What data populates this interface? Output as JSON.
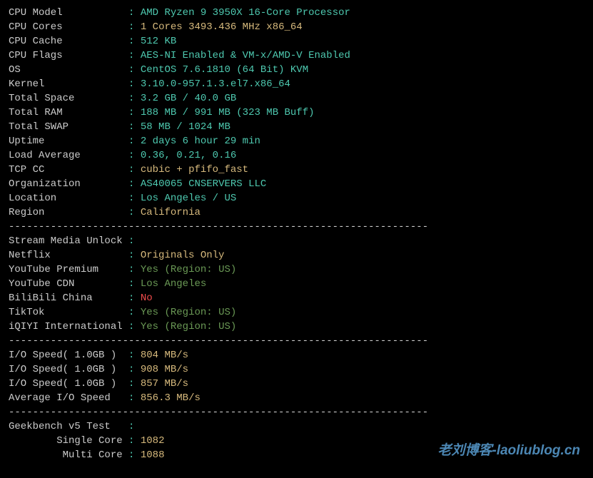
{
  "labels": {
    "cpu_model": "CPU Model",
    "cpu_cores": "CPU Cores",
    "cpu_cache": "CPU Cache",
    "cpu_flags": "CPU Flags",
    "os": "OS",
    "kernel": "Kernel",
    "total_space": "Total Space",
    "total_ram": "Total RAM",
    "total_swap": "Total SWAP",
    "uptime": "Uptime",
    "load_average": "Load Average",
    "tcp_cc": "TCP CC",
    "organization": "Organization",
    "location": "Location",
    "region": "Region",
    "stream_media_unlock": "Stream Media Unlock",
    "netflix": "Netflix",
    "youtube_premium": "YouTube Premium",
    "youtube_cdn": "YouTube CDN",
    "bilibili_china": "BiliBili China",
    "tiktok": "TikTok",
    "iqiyi_intl": "iQIYI International",
    "io_speed": "I/O Speed( 1.0GB )",
    "avg_io_speed": "Average I/O Speed",
    "geekbench": "Geekbench v5 Test",
    "single_core": "Single Core",
    "multi_core": "Multi Core"
  },
  "values": {
    "cpu_model": "AMD Ryzen 9 3950X 16-Core Processor",
    "cpu_cores": "1 Cores 3493.436 MHz x86_64",
    "cpu_cache": "512 KB",
    "cpu_flags": "AES-NI Enabled & VM-x/AMD-V Enabled",
    "os": "CentOS 7.6.1810 (64 Bit) KVM",
    "kernel": "3.10.0-957.1.3.el7.x86_64",
    "total_space": "3.2 GB / 40.0 GB",
    "total_ram": "188 MB / 991 MB (323 MB Buff)",
    "total_swap": "58 MB / 1024 MB",
    "uptime": "2 days 6 hour 29 min",
    "load_average": "0.36, 0.21, 0.16",
    "tcp_cc": "cubic + pfifo_fast",
    "organization": "AS40065 CNSERVERS LLC",
    "location": "Los Angeles / US",
    "region": "California",
    "netflix": "Originals Only",
    "youtube_premium": "Yes (Region: US)",
    "youtube_cdn": "Los Angeles",
    "bilibili_china": "No",
    "tiktok": "Yes (Region: US)",
    "iqiyi_intl": "Yes (Region: US)",
    "io_speed_1": "804 MB/s",
    "io_speed_2": "908 MB/s",
    "io_speed_3": "857 MB/s",
    "avg_io_speed": "856.3 MB/s",
    "single_core": "1082",
    "multi_core": "1088"
  },
  "divider": "----------------------------------------------------------------------",
  "watermark": "老刘博客-laoliublog.cn"
}
